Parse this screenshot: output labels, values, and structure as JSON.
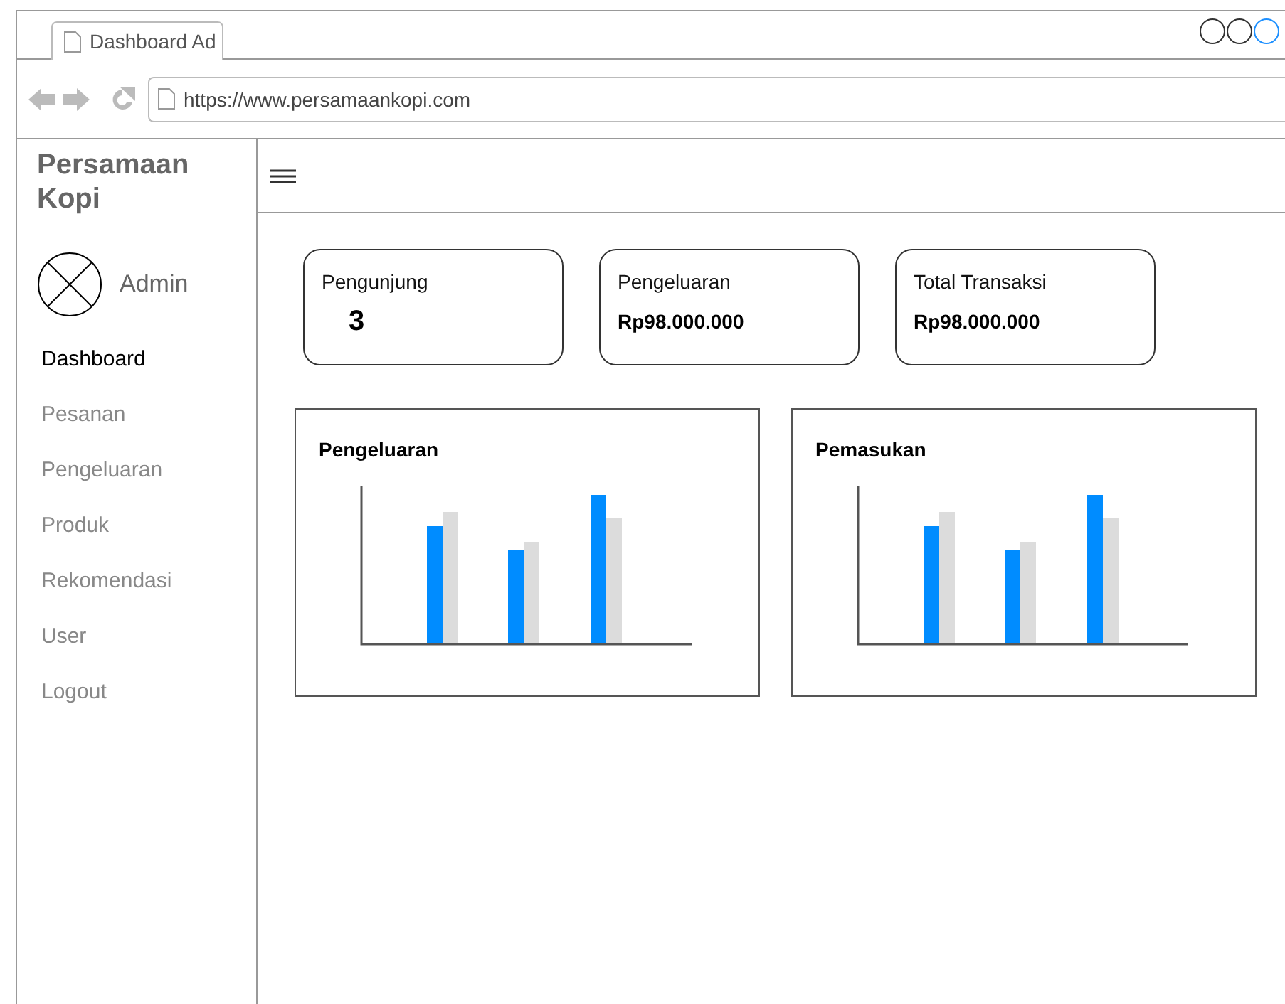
{
  "browser": {
    "tab_title": "Dashboard Ad",
    "url": "https://www.persamaankopi.com"
  },
  "sidebar": {
    "brand": "Persamaan Kopi",
    "user": "Admin",
    "items": [
      {
        "label": "Dashboard",
        "selected": true
      },
      {
        "label": "Pesanan",
        "selected": false
      },
      {
        "label": "Pengeluaran",
        "selected": false
      },
      {
        "label": "Produk",
        "selected": false
      },
      {
        "label": "Rekomendasi",
        "selected": false
      },
      {
        "label": "User",
        "selected": false
      },
      {
        "label": "Logout",
        "selected": false
      }
    ]
  },
  "stats": [
    {
      "label": "Pengunjung",
      "value": "3",
      "kind": "count"
    },
    {
      "label": "Pengeluaran",
      "value": "Rp98.000.000",
      "kind": "amount"
    },
    {
      "label": "Total Transaksi",
      "value": "Rp98.000.000",
      "kind": "amount"
    }
  ],
  "charts": [
    {
      "title": "Pengeluaran"
    },
    {
      "title": "Pemasukan"
    }
  ]
}
